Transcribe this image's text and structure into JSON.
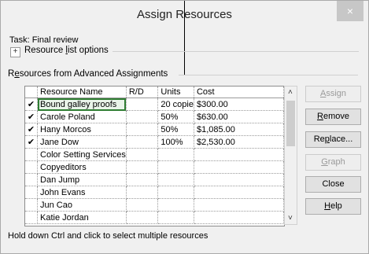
{
  "dialog": {
    "title": "Assign Resources",
    "close_label": "×"
  },
  "task": {
    "label": "Task: Final review"
  },
  "resource_list_options": {
    "expander": "+",
    "pre": "Resource ",
    "underlined": "l",
    "post": "ist options"
  },
  "assignments_section": {
    "pre": "R",
    "underlined": "e",
    "post": "sources from Advanced Assignments"
  },
  "grid": {
    "columns": [
      "",
      "Resource Name",
      "R/D",
      "Units",
      "Cost"
    ],
    "rows": [
      {
        "check": "✔",
        "name": "Bound galley proofs",
        "rd": "",
        "units": "20 copie",
        "cost": "$300.00",
        "selected": true
      },
      {
        "check": "✔",
        "name": "Carole Poland",
        "rd": "",
        "units": "50%",
        "cost": "$630.00"
      },
      {
        "check": "✔",
        "name": "Hany Morcos",
        "rd": "",
        "units": "50%",
        "cost": "$1,085.00"
      },
      {
        "check": "✔",
        "name": "Jane Dow",
        "rd": "",
        "units": "100%",
        "cost": "$2,530.00"
      },
      {
        "check": "",
        "name": "Color Setting Services",
        "rd": "",
        "units": "",
        "cost": ""
      },
      {
        "check": "",
        "name": "Copyeditors",
        "rd": "",
        "units": "",
        "cost": ""
      },
      {
        "check": "",
        "name": "Dan Jump",
        "rd": "",
        "units": "",
        "cost": ""
      },
      {
        "check": "",
        "name": "John Evans",
        "rd": "",
        "units": "",
        "cost": ""
      },
      {
        "check": "",
        "name": "Jun Cao",
        "rd": "",
        "units": "",
        "cost": ""
      },
      {
        "check": "",
        "name": "Katie Jordan",
        "rd": "",
        "units": "",
        "cost": ""
      }
    ]
  },
  "scrollbar": {
    "up": "˄",
    "down": "˅"
  },
  "buttons": {
    "assign": {
      "pre": "",
      "u": "A",
      "post": "ssign"
    },
    "remove": {
      "pre": "",
      "u": "R",
      "post": "emove"
    },
    "replace": {
      "pre": "Re",
      "u": "p",
      "post": "lace..."
    },
    "graph": {
      "pre": "",
      "u": "G",
      "post": "raph"
    },
    "close": {
      "label": "Close"
    },
    "help": {
      "pre": "",
      "u": "H",
      "post": "elp"
    }
  },
  "footer": "Hold down Ctrl and click to select multiple resources"
}
